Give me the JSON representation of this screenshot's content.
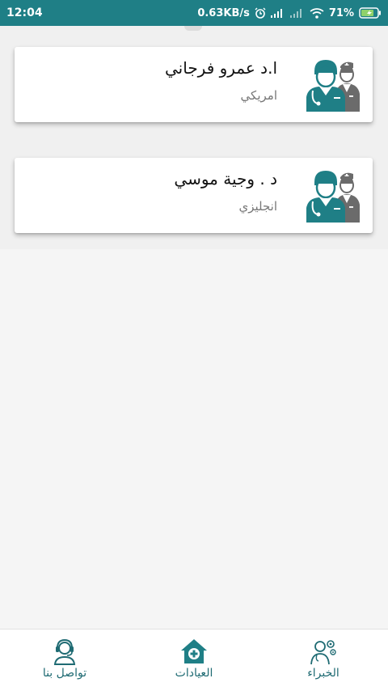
{
  "status_bar": {
    "time": "12:04",
    "network_speed": "0.63KB/s",
    "battery_percent": "71%"
  },
  "doctors": [
    {
      "name": "ا.د عمرو فرجاني",
      "language": "امريكي",
      "icon": "doctor-nurse-icon"
    },
    {
      "name": "د . وجية موسي",
      "language": "انجليزي",
      "icon": "doctor-nurse-icon"
    }
  ],
  "bottom_nav": {
    "experts_label": "الخبراء",
    "clinics_label": "العيادات",
    "contact_label": "تواصل بنا"
  },
  "colors": {
    "primary": "#1f7f86",
    "accent": "#2a8a90",
    "nurse_gray": "#6b6b6b"
  }
}
